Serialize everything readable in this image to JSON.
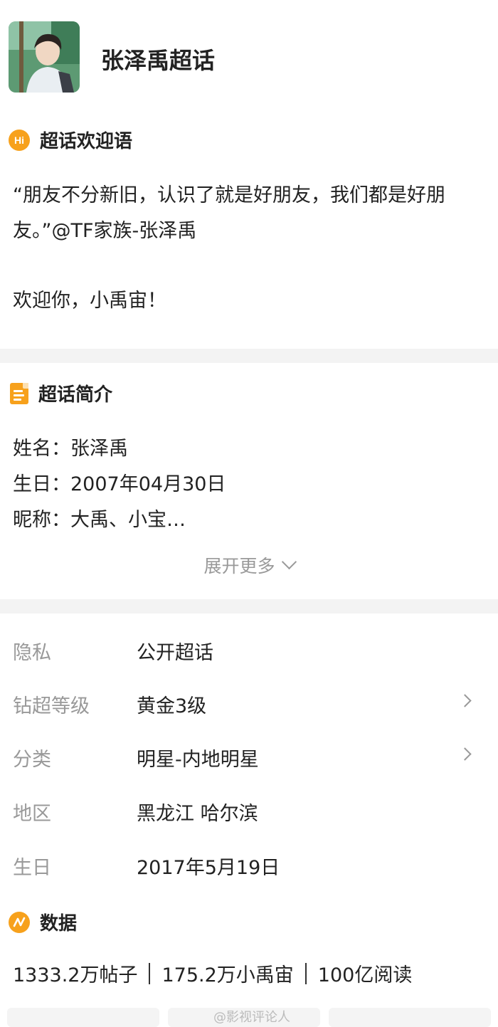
{
  "header": {
    "title": "张泽禹超话"
  },
  "welcome": {
    "section_title": "超话欢迎语",
    "icon": "hi-icon",
    "icon_text": "Hi",
    "quote": "“朋友不分新旧，认识了就是好朋友，我们都是好朋友。”@TF家族-张泽禹",
    "greeting": "欢迎你，小禹宙！"
  },
  "intro": {
    "section_title": "超话简介",
    "icon": "document-icon",
    "lines": [
      "姓名：张泽禹",
      "生日：2007年04月30日",
      "昵称：大禹、小宝…"
    ],
    "expand_label": "展开更多"
  },
  "info": {
    "rows": [
      {
        "label": "隐私",
        "value": "公开超话",
        "has_arrow": false
      },
      {
        "label": "钻超等级",
        "value": "黄金3级",
        "has_arrow": true
      },
      {
        "label": "分类",
        "value": "明星-内地明星",
        "has_arrow": true
      },
      {
        "label": "地区",
        "value": "黑龙江 哈尔滨",
        "has_arrow": false
      },
      {
        "label": "生日",
        "value": "2017年5月19日",
        "has_arrow": false
      }
    ]
  },
  "data": {
    "section_title": "数据",
    "icon": "data-icon",
    "stats": [
      "1333.2万帖子",
      "175.2万小禹宙",
      "100亿阅读"
    ]
  },
  "watermark": "@影视评论人",
  "colors": {
    "accent": "#f7a11c",
    "label_gray": "#999999",
    "divider": "#f3f3f3"
  }
}
